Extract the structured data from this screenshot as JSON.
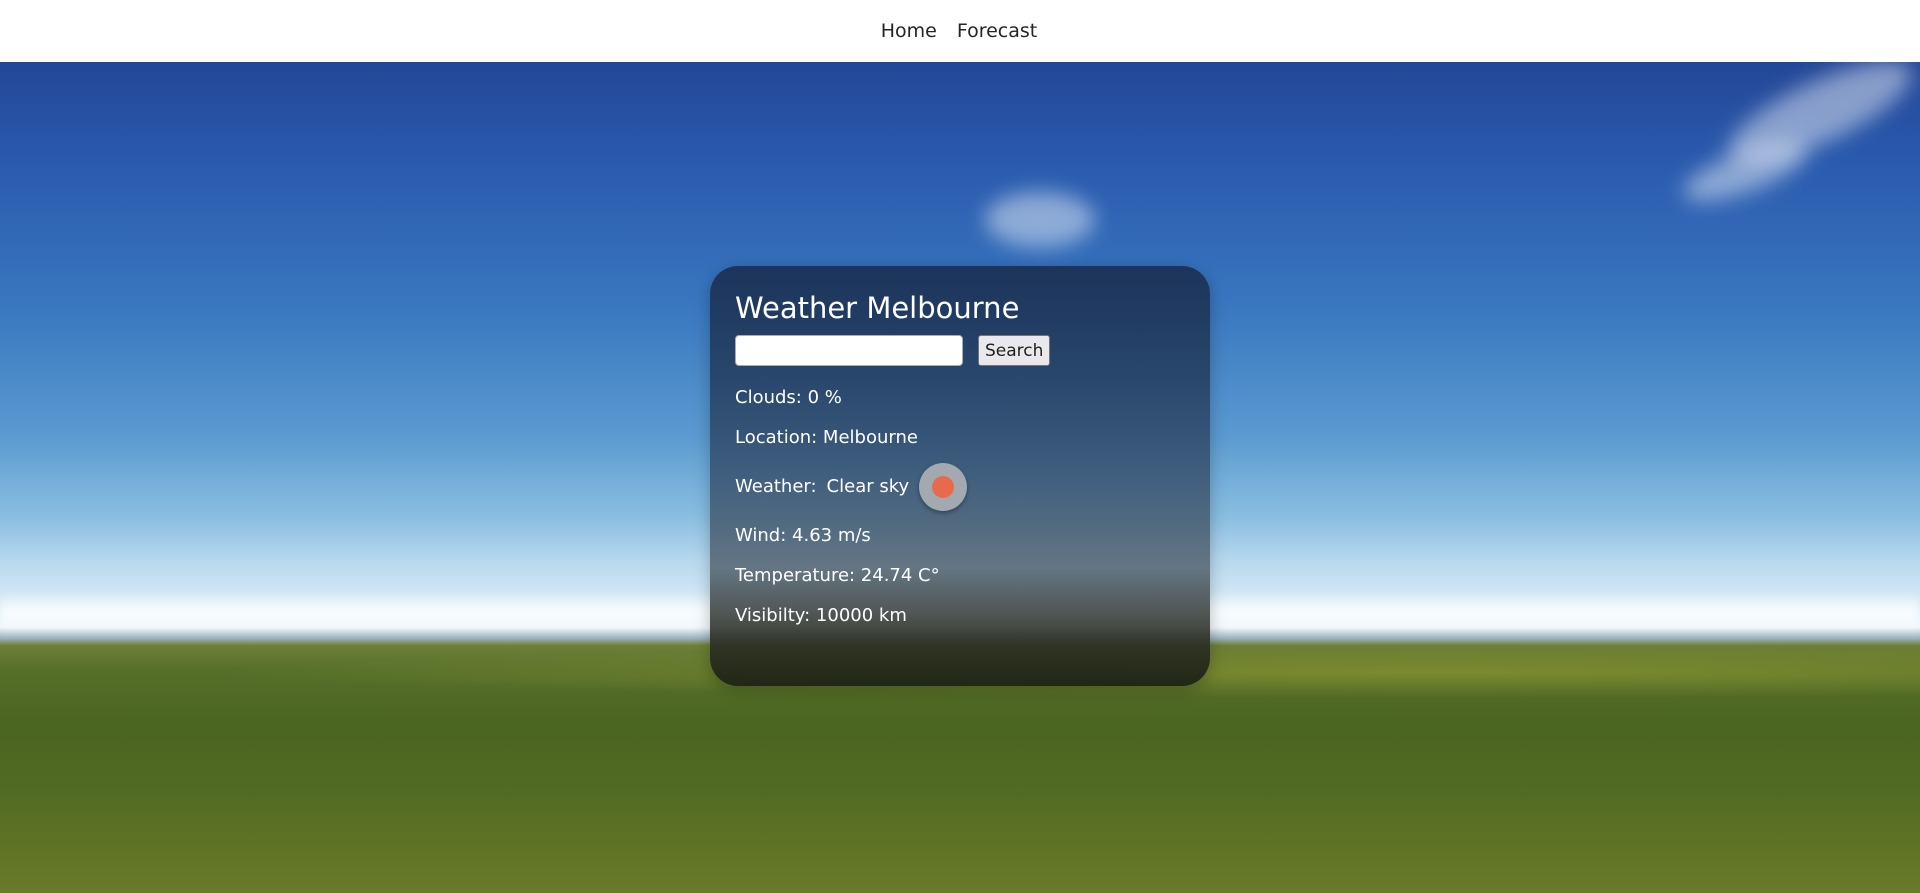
{
  "nav": {
    "items": [
      {
        "label": "Home"
      },
      {
        "label": "Forecast"
      }
    ]
  },
  "card": {
    "title": "Weather Melbourne",
    "search": {
      "value": "",
      "placeholder": "",
      "button_label": "Search"
    },
    "clouds": "Clouds: 0 %",
    "location": "Location: Melbourne",
    "weather_label": "Weather:",
    "weather_value": "Clear sky",
    "weather_icon": "clear-sky-sun-icon",
    "wind": "Wind: 4.63 m/s",
    "temperature": "Temperature: 24.74 C°",
    "visibility": "Visibilty: 10000 km"
  },
  "colors": {
    "sun_dot": "#e86a4c",
    "icon_bg": "#a3a9b1",
    "card_top": "#1a2f52",
    "nav_bg": "#ffffff"
  }
}
